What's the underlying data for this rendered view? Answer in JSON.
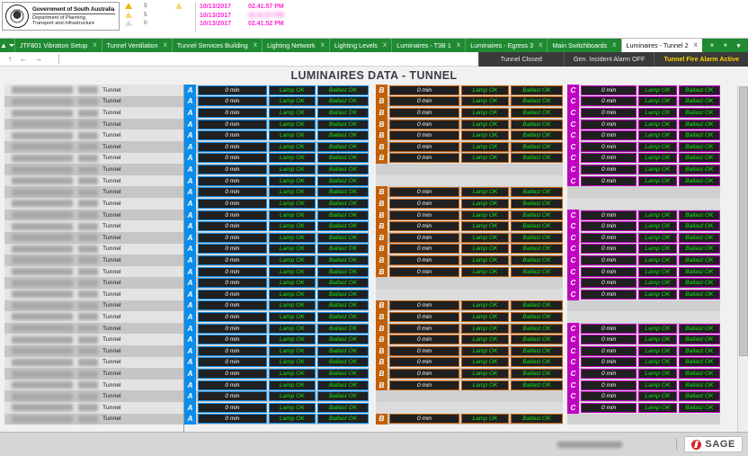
{
  "header": {
    "government": {
      "title": "Government of South Australia",
      "dept_line1": "Department of Planning,",
      "dept_line2": "Transport and Infrastructure",
      "crest_icon": "coat-of-arms-icon"
    },
    "alarm_counts": [
      {
        "icon": "warning-triangle-icon",
        "count": "5"
      },
      {
        "icon": "warning-triangle-acknowledged-icon",
        "count": "5"
      },
      {
        "icon": "warning-triangle-disabled-icon",
        "count": "0"
      }
    ],
    "bell_icon": "alarm-bell-icon",
    "alarm_rows": [
      {
        "date": "10/13/2017",
        "time": "02.41.57 PM",
        "source": "",
        "description": "",
        "location": "",
        "value": ""
      },
      {
        "date": "10/13/2017",
        "time": "02.41.57 PM",
        "source": "",
        "description": "",
        "location": "",
        "value": ""
      },
      {
        "date": "10/13/2017",
        "time": "02.41.52 PM",
        "source": "",
        "description": "",
        "location": "",
        "value": ""
      }
    ]
  },
  "tabbar": {
    "home_icon": "home-icon",
    "home_caret_icon": "chevron-down-icon",
    "tabs": [
      {
        "label": "JTF801 Vibration Setup",
        "close": "X",
        "active": false
      },
      {
        "label": "Tunnel Ventilation",
        "close": "X",
        "active": false
      },
      {
        "label": "Tunnel Services Building",
        "close": "X",
        "active": false
      },
      {
        "label": "Lighting Network",
        "close": "X",
        "active": false
      },
      {
        "label": "Lighting Levels",
        "close": "X",
        "active": false
      },
      {
        "label": "Luminaires - T3B 1",
        "close": "X",
        "active": false
      },
      {
        "label": "Luminaires - Egress 3",
        "close": "X",
        "active": false
      },
      {
        "label": "Main Switchboards",
        "close": "X",
        "active": false
      },
      {
        "label": "Luminaires - Tunnel 2",
        "close": "X",
        "active": true
      }
    ],
    "scroll_left_icon": "«",
    "scroll_right_icon": "»",
    "tab_menu_icon": "▾"
  },
  "subbar": {
    "nav_up_icon": "↑",
    "nav_back_icon": "←",
    "nav_forward_icon": "→",
    "status": [
      {
        "label": "Tunnel Closed",
        "state": "normal"
      },
      {
        "label": "Gen. Incident Alarm OFF",
        "state": "normal"
      },
      {
        "label": "Tunnel Fire Alarm Active",
        "state": "alarm"
      }
    ]
  },
  "page": {
    "title": "LUMINAIRES DATA - TUNNEL"
  },
  "grid": {
    "zone_label": "Tunnel",
    "circuits": [
      {
        "id": "A",
        "badge": "A",
        "color": "#0c8ce9",
        "rows": [
          {
            "value": "0 min",
            "lamp": "Lamp OK",
            "ballast": "Ballast OK"
          },
          {
            "value": "0 min",
            "lamp": "Lamp OK",
            "ballast": "Ballast OK"
          },
          {
            "value": "0 min",
            "lamp": "Lamp OK",
            "ballast": "Ballast OK"
          },
          {
            "value": "0 min",
            "lamp": "Lamp OK",
            "ballast": "Ballast OK"
          },
          {
            "value": "0 min",
            "lamp": "Lamp OK",
            "ballast": "Ballast OK"
          },
          {
            "value": "0 min",
            "lamp": "Lamp OK",
            "ballast": "Ballast OK"
          },
          {
            "value": "0 min",
            "lamp": "Lamp OK",
            "ballast": "Ballast OK"
          },
          {
            "value": "0 min",
            "lamp": "Lamp OK",
            "ballast": "Ballast OK"
          },
          {
            "value": "0 min",
            "lamp": "Lamp OK",
            "ballast": "Ballast OK"
          },
          {
            "value": "0 min",
            "lamp": "Lamp OK",
            "ballast": "Ballast OK"
          },
          {
            "value": "0 min",
            "lamp": "Lamp OK",
            "ballast": "Ballast OK"
          },
          {
            "value": "0 min",
            "lamp": "Lamp OK",
            "ballast": "Ballast OK"
          },
          {
            "value": "0 min",
            "lamp": "Lamp OK",
            "ballast": "Ballast OK"
          },
          {
            "value": "0 min",
            "lamp": "Lamp OK",
            "ballast": "Ballast OK"
          },
          {
            "value": "0 min",
            "lamp": "Lamp OK",
            "ballast": "Ballast OK"
          },
          {
            "value": "0 min",
            "lamp": "Lamp OK",
            "ballast": "Ballast OK"
          },
          {
            "value": "0 min",
            "lamp": "Lamp OK",
            "ballast": "Ballast OK"
          },
          {
            "value": "0 min",
            "lamp": "Lamp OK",
            "ballast": "Ballast OK"
          },
          {
            "value": "0 min",
            "lamp": "Lamp OK",
            "ballast": "Ballast OK"
          },
          {
            "value": "0 min",
            "lamp": "Lamp OK",
            "ballast": "Ballast OK"
          },
          {
            "value": "0 min",
            "lamp": "Lamp OK",
            "ballast": "Ballast OK"
          },
          {
            "value": "0 min",
            "lamp": "Lamp OK",
            "ballast": "Ballast OK"
          },
          {
            "value": "0 min",
            "lamp": "Lamp OK",
            "ballast": "Ballast OK"
          },
          {
            "value": "0 min",
            "lamp": "Lamp OK",
            "ballast": "Ballast OK"
          },
          {
            "value": "0 min",
            "lamp": "Lamp OK",
            "ballast": "Ballast OK"
          },
          {
            "value": "0 min",
            "lamp": "Lamp OK",
            "ballast": "Ballast OK"
          },
          {
            "value": "0 min",
            "lamp": "Lamp OK",
            "ballast": "Ballast OK"
          },
          {
            "value": "0 min",
            "lamp": "Lamp OK",
            "ballast": "Ballast OK"
          },
          {
            "value": "0 min",
            "lamp": "Lamp OK",
            "ballast": "Ballast OK"
          },
          {
            "value": "0 min",
            "lamp": "Lamp OK",
            "ballast": "Ballast OK"
          }
        ]
      },
      {
        "id": "B",
        "badge": "B",
        "color": "#c1600c",
        "gap_after": [
          7,
          15,
          23
        ],
        "rows": [
          {
            "value": "0 min",
            "lamp": "Lamp OK",
            "ballast": "Ballast OK"
          },
          {
            "value": "0 min",
            "lamp": "Lamp OK",
            "ballast": "Ballast OK"
          },
          {
            "value": "0 min",
            "lamp": "Lamp OK",
            "ballast": "Ballast OK"
          },
          {
            "value": "0 min",
            "lamp": "Lamp OK",
            "ballast": "Ballast OK"
          },
          {
            "value": "0 min",
            "lamp": "Lamp OK",
            "ballast": "Ballast OK"
          },
          {
            "value": "0 min",
            "lamp": "Lamp OK",
            "ballast": "Ballast OK"
          },
          {
            "value": "0 min",
            "lamp": "Lamp OK",
            "ballast": "Ballast OK"
          },
          {
            "value": "0 min",
            "lamp": "Lamp OK",
            "ballast": "Ballast OK"
          },
          {
            "value": "0 min",
            "lamp": "Lamp OK",
            "ballast": "Ballast OK"
          },
          {
            "value": "0 min",
            "lamp": "Lamp OK",
            "ballast": "Ballast OK"
          },
          {
            "value": "0 min",
            "lamp": "Lamp OK",
            "ballast": "Ballast OK"
          },
          {
            "value": "0 min",
            "lamp": "Lamp OK",
            "ballast": "Ballast OK"
          },
          {
            "value": "0 min",
            "lamp": "Lamp OK",
            "ballast": "Ballast OK"
          },
          {
            "value": "0 min",
            "lamp": "Lamp OK",
            "ballast": "Ballast OK"
          },
          {
            "value": "0 min",
            "lamp": "Lamp OK",
            "ballast": "Ballast OK"
          },
          {
            "value": "0 min",
            "lamp": "Lamp OK",
            "ballast": "Ballast OK"
          },
          {
            "value": "0 min",
            "lamp": "Lamp OK",
            "ballast": "Ballast OK"
          },
          {
            "value": "0 min",
            "lamp": "Lamp OK",
            "ballast": "Ballast OK"
          },
          {
            "value": "0 min",
            "lamp": "Lamp OK",
            "ballast": "Ballast OK"
          },
          {
            "value": "0 min",
            "lamp": "Lamp OK",
            "ballast": "Ballast OK"
          },
          {
            "value": "0 min",
            "lamp": "Lamp OK",
            "ballast": "Ballast OK"
          },
          {
            "value": "0 min",
            "lamp": "Lamp OK",
            "ballast": "Ballast OK"
          },
          {
            "value": "0 min",
            "lamp": "Lamp OK",
            "ballast": "Ballast OK"
          },
          {
            "value": "0 min",
            "lamp": "Lamp OK",
            "ballast": "Ballast OK"
          }
        ]
      },
      {
        "id": "C",
        "badge": "C",
        "color": "#c200c2",
        "gap_after": [
          9,
          17,
          25
        ],
        "rows": [
          {
            "value": "0 min",
            "lamp": "Lamp OK",
            "ballast": "Ballast OK"
          },
          {
            "value": "0 min",
            "lamp": "Lamp OK",
            "ballast": "Ballast OK"
          },
          {
            "value": "0 min",
            "lamp": "Lamp OK",
            "ballast": "Ballast OK"
          },
          {
            "value": "0 min",
            "lamp": "Lamp OK",
            "ballast": "Ballast OK"
          },
          {
            "value": "0 min",
            "lamp": "Lamp OK",
            "ballast": "Ballast OK"
          },
          {
            "value": "0 min",
            "lamp": "Lamp OK",
            "ballast": "Ballast OK"
          },
          {
            "value": "0 min",
            "lamp": "Lamp OK",
            "ballast": "Ballast OK"
          },
          {
            "value": "0 min",
            "lamp": "Lamp OK",
            "ballast": "Ballast OK"
          },
          {
            "value": "0 min",
            "lamp": "Lamp OK",
            "ballast": "Ballast OK"
          },
          {
            "value": "0 min",
            "lamp": "Lamp OK",
            "ballast": "Ballast OK"
          },
          {
            "value": "0 min",
            "lamp": "Lamp OK",
            "ballast": "Ballast OK"
          },
          {
            "value": "0 min",
            "lamp": "Lamp OK",
            "ballast": "Ballast OK"
          },
          {
            "value": "0 min",
            "lamp": "Lamp OK",
            "ballast": "Ballast OK"
          },
          {
            "value": "0 min",
            "lamp": "Lamp OK",
            "ballast": "Ballast OK"
          },
          {
            "value": "0 min",
            "lamp": "Lamp OK",
            "ballast": "Ballast OK"
          },
          {
            "value": "0 min",
            "lamp": "Lamp OK",
            "ballast": "Ballast OK"
          },
          {
            "value": "0 min",
            "lamp": "Lamp OK",
            "ballast": "Ballast OK"
          },
          {
            "value": "0 min",
            "lamp": "Lamp OK",
            "ballast": "Ballast OK"
          },
          {
            "value": "0 min",
            "lamp": "Lamp OK",
            "ballast": "Ballast OK"
          },
          {
            "value": "0 min",
            "lamp": "Lamp OK",
            "ballast": "Ballast OK"
          },
          {
            "value": "0 min",
            "lamp": "Lamp OK",
            "ballast": "Ballast OK"
          },
          {
            "value": "0 min",
            "lamp": "Lamp OK",
            "ballast": "Ballast OK"
          },
          {
            "value": "0 min",
            "lamp": "Lamp OK",
            "ballast": "Ballast OK"
          },
          {
            "value": "0 min",
            "lamp": "Lamp OK",
            "ballast": "Ballast OK"
          },
          {
            "value": "0 min",
            "lamp": "Lamp OK",
            "ballast": "Ballast OK"
          },
          {
            "value": "0 min",
            "lamp": "Lamp OK",
            "ballast": "Ballast OK"
          }
        ]
      }
    ]
  },
  "footer": {
    "vendor": "SAGE",
    "vendor_icon": "sage-logo-icon"
  }
}
